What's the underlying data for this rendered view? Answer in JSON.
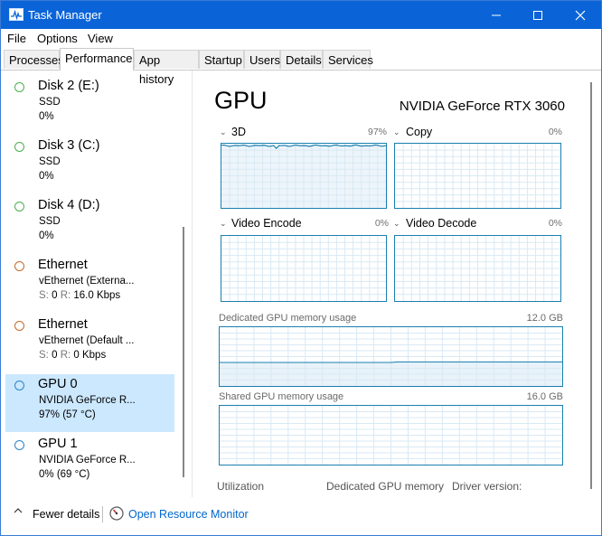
{
  "window": {
    "title": "Task Manager"
  },
  "menu": {
    "items": [
      "File",
      "Options",
      "View"
    ]
  },
  "tabs": [
    "Processes",
    "Performance",
    "App history",
    "Startup",
    "Users",
    "Details",
    "Services"
  ],
  "sidebar": {
    "items": [
      {
        "name": "Disk 2 (E:)",
        "sub1": "SSD",
        "sub2": "0%",
        "color": "#4caf50"
      },
      {
        "name": "Disk 3 (C:)",
        "sub1": "SSD",
        "sub2": "0%",
        "color": "#4caf50"
      },
      {
        "name": "Disk 4 (D:)",
        "sub1": "SSD",
        "sub2": "0%",
        "color": "#4caf50"
      },
      {
        "name": "Ethernet",
        "sub1": "vEthernet (Externa...",
        "s_label": "S:",
        "s_val": "0",
        "r_label": "R:",
        "r_val": "16.0 Kbps",
        "color": "#c56a2a"
      },
      {
        "name": "Ethernet",
        "sub1": "vEthernet (Default ...",
        "s_label": "S:",
        "s_val": "0",
        "r_label": "R:",
        "r_val": "0 Kbps",
        "color": "#c56a2a"
      },
      {
        "name": "GPU 0",
        "sub1": "NVIDIA GeForce R...",
        "sub2": "97%  (57 °C)",
        "color": "#2a85c5",
        "selected": true
      },
      {
        "name": "GPU 1",
        "sub1": "NVIDIA GeForce R...",
        "sub2": "0%  (69 °C)",
        "color": "#2a85c5"
      }
    ]
  },
  "gpu": {
    "title": "GPU",
    "model": "NVIDIA GeForce RTX 3060",
    "engines": [
      {
        "label": "3D",
        "pct": "97%",
        "value": 0.97
      },
      {
        "label": "Copy",
        "pct": "0%",
        "value": 0
      },
      {
        "label": "Video Encode",
        "pct": "0%",
        "value": 0
      },
      {
        "label": "Video Decode",
        "pct": "0%",
        "value": 0
      }
    ],
    "dedicated": {
      "label": "Dedicated GPU memory usage",
      "max": "12.0 GB"
    },
    "shared": {
      "label": "Shared GPU memory usage",
      "max": "16.0 GB"
    },
    "bottom": {
      "utilization": "Utilization",
      "dedicated": "Dedicated GPU memory",
      "driver": "Driver version:"
    }
  },
  "colors": {
    "accent": "#1a7fb0",
    "graph_fill": "#e8f2f9",
    "selected_bg": "#cce8ff",
    "titlebar": "#0a64d8"
  },
  "footer": {
    "fewer_details": "Fewer details",
    "resource_monitor": "Open Resource Monitor"
  }
}
